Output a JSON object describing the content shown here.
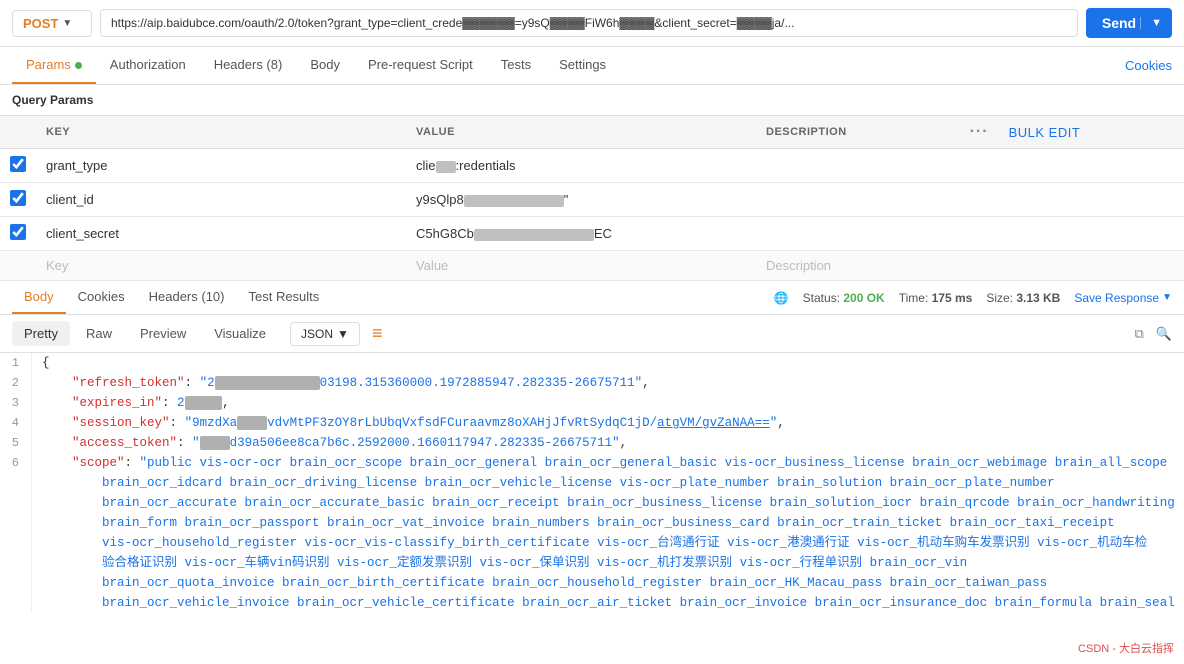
{
  "topbar": {
    "method": "POST",
    "url": "https://aip.baidubce.com/oauth/2.0/token?grant_type=client_crede██████=y9sQ██████FiW6h██████&client_secret=██████ja/...",
    "send_label": "Send"
  },
  "nav_tabs": {
    "params": "Params",
    "params_dot": true,
    "authorization": "Authorization",
    "headers": "Headers",
    "headers_count": "8",
    "body": "Body",
    "prerequest": "Pre-request Script",
    "tests": "Tests",
    "settings": "Settings",
    "cookies": "Cookies"
  },
  "query_params": {
    "label": "Query Params",
    "columns": {
      "key": "KEY",
      "value": "VALUE",
      "description": "DESCRIPTION",
      "bulk_edit": "Bulk Edit"
    },
    "rows": [
      {
        "checked": true,
        "key": "grant_type",
        "value": "clie██:redentials",
        "description": ""
      },
      {
        "checked": true,
        "key": "client_id",
        "value": "y9sQlp8██████████████",
        "description": ""
      },
      {
        "checked": true,
        "key": "client_secret",
        "value": "C5hG8Cb██████████████EC",
        "description": ""
      }
    ],
    "placeholder_key": "Key",
    "placeholder_value": "Value",
    "placeholder_desc": "Description"
  },
  "body_section": {
    "tabs": [
      "Body",
      "Cookies",
      "Headers (10)",
      "Test Results"
    ],
    "active_tab": "Body",
    "status_label": "Status:",
    "status_value": "200 OK",
    "time_label": "Time:",
    "time_value": "175 ms",
    "size_label": "Size:",
    "size_value": "3.13 KB",
    "save_response": "Save Response"
  },
  "format_bar": {
    "tabs": [
      "Pretty",
      "Raw",
      "Preview",
      "Visualize"
    ],
    "active": "Pretty",
    "format": "JSON",
    "filter_icon": "≡"
  },
  "json_response": {
    "lines": [
      {
        "num": 1,
        "content": "{"
      },
      {
        "num": 2,
        "content": "    \"refresh_token\": \"2██████████████03198.315360000.1972885947.282335-26675711\","
      },
      {
        "num": 3,
        "content": "    \"expires_in\": 2██████████████,"
      },
      {
        "num": 4,
        "content": "    \"session_key\": \"9mzdXa██████vdvMtPF3zOY8rLbUbqVxfsdFCuraavmz8oXAHjJfvRtSydqC1jD/atgVM/gvZaNAA==\","
      },
      {
        "num": 5,
        "content": "    \"access_token\": \"██████d39a506ee8ca7b6c.2592000.1660117947.282335-26675711\","
      },
      {
        "num": 6,
        "content": "    \"scope\": \"public vis-ocr-ocr brain_ocr_scope brain_ocr_general brain_ocr_general_basic vis-ocr_business_license brain_ocr_webimage brain_all_scope"
      },
      {
        "num": "",
        "content": "        brain_ocr_idcard brain_ocr_driving_license brain_ocr_vehicle_license vis-ocr_plate_number brain_solution brain_ocr_plate_number"
      },
      {
        "num": "",
        "content": "        brain_ocr_accurate brain_ocr_accurate_basic brain_ocr_receipt brain_ocr_business_license brain_solution_iocr brain_qrcode brain_ocr_handwriting"
      },
      {
        "num": "",
        "content": "        brain_form brain_ocr_passport brain_ocr_vat_invoice brain_numbers brain_ocr_business_card brain_ocr_train_ticket brain_ocr_taxi_receipt"
      },
      {
        "num": "",
        "content": "        vis-ocr_household_register vis-ocr_vis-classify_birth_certificate vis-ocr_台湾通行证 vis-ocr_港澳通行证 vis-ocr_机动车购车发票识别 vis-ocr_机动车检"
      },
      {
        "num": "",
        "content": "        验合格证识别 vis-ocr_车辆vin码识别 vis-ocr_定额发票识别 vis-ocr_保单识别 vis-ocr_机打发票识别 vis-ocr_行程单识别 brain_ocr_vin"
      },
      {
        "num": "",
        "content": "        brain_ocr_quota_invoice brain_ocr_birth_certificate brain_ocr_household_register brain_ocr_HK_Macau_pass brain_ocr_taiwan_pass"
      },
      {
        "num": "",
        "content": "        brain_ocr_vehicle_invoice brain_ocr_vehicle_certificate brain_ocr_air_ticket brain_ocr_invoice brain_ocr_insurance_doc brain_formula brain_seal"
      }
    ]
  },
  "watermark": "CSDN - 大白云指挥"
}
